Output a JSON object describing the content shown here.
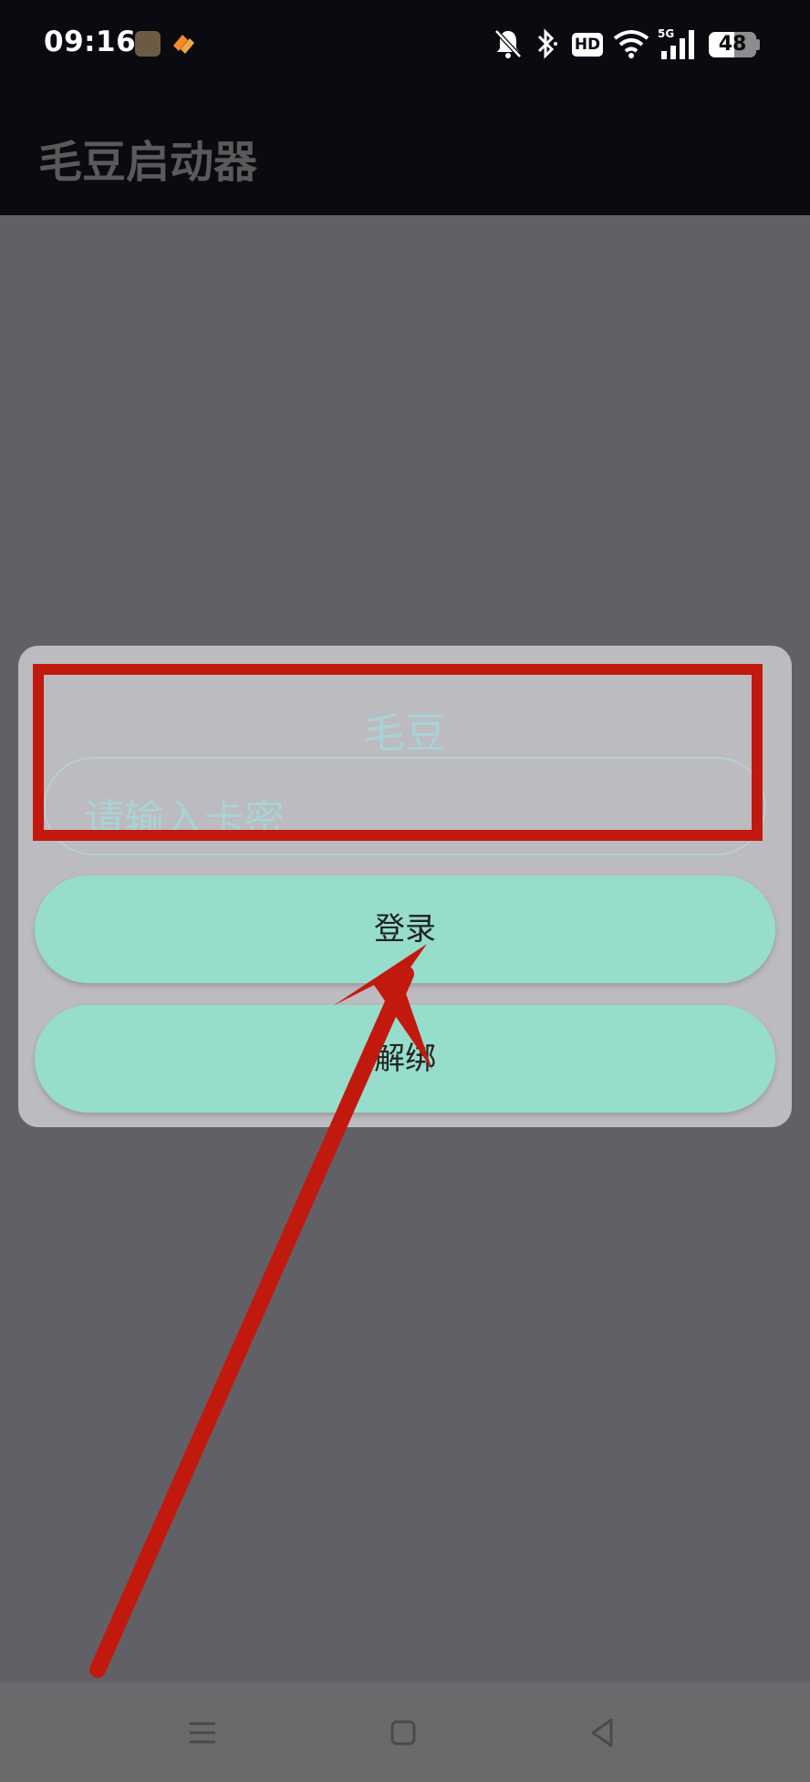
{
  "status_bar": {
    "time": "09:16",
    "battery_level": "48",
    "network": "5G",
    "hd_label": "HD",
    "icons": [
      "game-app-icon",
      "orange-app-icon",
      "bell-off-icon",
      "bluetooth-icon",
      "hd-icon",
      "wifi-icon",
      "cell-signal-icon",
      "battery-icon"
    ]
  },
  "app_bar": {
    "title": "毛豆启动器"
  },
  "dialog": {
    "title": "毛豆",
    "key_input": {
      "placeholder": "请输入卡密",
      "value": ""
    },
    "login_label": "登录",
    "unbind_label": "解绑"
  },
  "annotations": {
    "highlight_color": "#c2190e",
    "arrow_color": "#c2190e"
  },
  "nav_bar": {
    "icons": [
      "menu-icon",
      "home-icon",
      "back-icon"
    ]
  }
}
